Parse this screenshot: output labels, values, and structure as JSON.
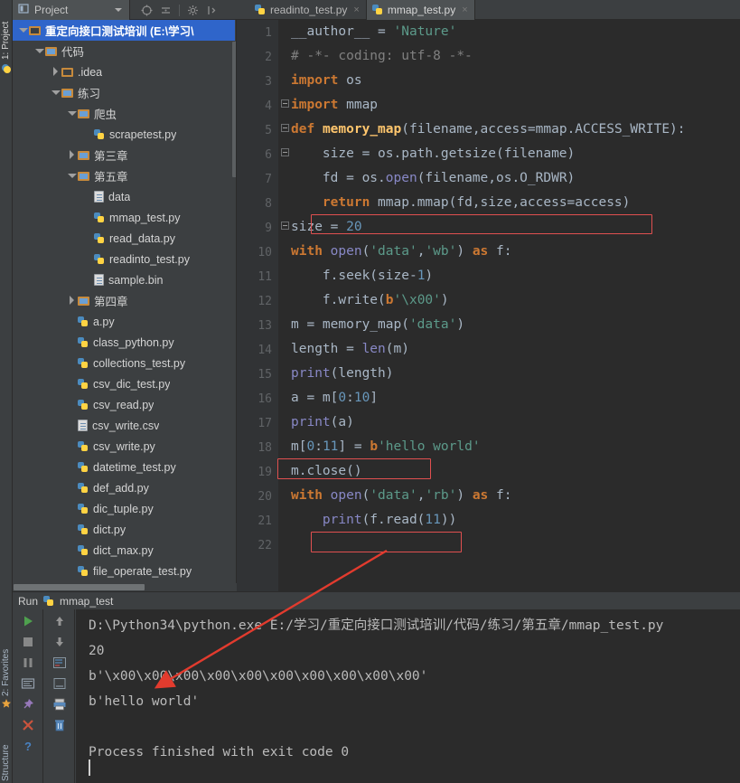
{
  "window": {
    "theme_bg": "#3c3f41",
    "editor_bg": "#2b2b2b",
    "accent": "#2f65ca",
    "highlight_box_color": "#e05050"
  },
  "left_strip": {
    "project_label": "1: Project",
    "favorites_label": "2: Favorites",
    "structure_label": "Structure"
  },
  "toolbar": {
    "project_label": "Project",
    "icons": [
      "target-icon",
      "collapse-all-icon",
      "settings-gear-icon",
      "expand-icon"
    ]
  },
  "tabs": [
    {
      "label": "readinto_test.py",
      "icon": "python-file-icon",
      "active": false,
      "close": "×"
    },
    {
      "label": "mmap_test.py",
      "icon": "python-file-icon",
      "active": true,
      "close": "×"
    }
  ],
  "project_tree": [
    {
      "label": "重定向接口测试培训 (E:\\学习\\",
      "depth": 0,
      "arrow": "down",
      "icon": "folder-plain",
      "selected": true
    },
    {
      "label": "代码",
      "depth": 1,
      "arrow": "down",
      "icon": "folder-src",
      "selected": false
    },
    {
      "label": ".idea",
      "depth": 2,
      "arrow": "right",
      "icon": "folder-plain",
      "selected": false
    },
    {
      "label": "练习",
      "depth": 2,
      "arrow": "down",
      "icon": "folder-src",
      "selected": false
    },
    {
      "label": "爬虫",
      "depth": 3,
      "arrow": "down",
      "icon": "folder-src",
      "selected": false
    },
    {
      "label": "scrapetest.py",
      "depth": 4,
      "arrow": "none",
      "icon": "python-file-icon",
      "selected": false
    },
    {
      "label": "第三章",
      "depth": 3,
      "arrow": "right",
      "icon": "folder-src",
      "selected": false
    },
    {
      "label": "第五章",
      "depth": 3,
      "arrow": "down",
      "icon": "folder-src",
      "selected": false
    },
    {
      "label": "data",
      "depth": 4,
      "arrow": "none",
      "icon": "file-icon",
      "selected": false
    },
    {
      "label": "mmap_test.py",
      "depth": 4,
      "arrow": "none",
      "icon": "python-file-icon",
      "selected": false
    },
    {
      "label": "read_data.py",
      "depth": 4,
      "arrow": "none",
      "icon": "python-file-icon",
      "selected": false
    },
    {
      "label": "readinto_test.py",
      "depth": 4,
      "arrow": "none",
      "icon": "python-file-icon",
      "selected": false
    },
    {
      "label": "sample.bin",
      "depth": 4,
      "arrow": "none",
      "icon": "file-icon",
      "selected": false
    },
    {
      "label": "第四章",
      "depth": 3,
      "arrow": "right",
      "icon": "folder-src",
      "selected": false
    },
    {
      "label": "a.py",
      "depth": 3,
      "arrow": "none",
      "icon": "python-file-icon",
      "selected": false
    },
    {
      "label": "class_python.py",
      "depth": 3,
      "arrow": "none",
      "icon": "python-file-icon",
      "selected": false
    },
    {
      "label": "collections_test.py",
      "depth": 3,
      "arrow": "none",
      "icon": "python-file-icon",
      "selected": false
    },
    {
      "label": "csv_dic_test.py",
      "depth": 3,
      "arrow": "none",
      "icon": "python-file-icon",
      "selected": false
    },
    {
      "label": "csv_read.py",
      "depth": 3,
      "arrow": "none",
      "icon": "python-file-icon",
      "selected": false
    },
    {
      "label": "csv_write.csv",
      "depth": 3,
      "arrow": "none",
      "icon": "file-icon",
      "selected": false
    },
    {
      "label": "csv_write.py",
      "depth": 3,
      "arrow": "none",
      "icon": "python-file-icon",
      "selected": false
    },
    {
      "label": "datetime_test.py",
      "depth": 3,
      "arrow": "none",
      "icon": "python-file-icon",
      "selected": false
    },
    {
      "label": "def_add.py",
      "depth": 3,
      "arrow": "none",
      "icon": "python-file-icon",
      "selected": false
    },
    {
      "label": "dic_tuple.py",
      "depth": 3,
      "arrow": "none",
      "icon": "python-file-icon",
      "selected": false
    },
    {
      "label": "dict.py",
      "depth": 3,
      "arrow": "none",
      "icon": "python-file-icon",
      "selected": false
    },
    {
      "label": "dict_max.py",
      "depth": 3,
      "arrow": "none",
      "icon": "python-file-icon",
      "selected": false
    },
    {
      "label": "file_operate_test.py",
      "depth": 3,
      "arrow": "none",
      "icon": "python-file-icon",
      "selected": false
    }
  ],
  "editor": {
    "file": "mmap_test.py",
    "first_line": 1,
    "last_line": 22,
    "line_numbers": [
      1,
      2,
      3,
      4,
      5,
      6,
      7,
      8,
      9,
      10,
      11,
      12,
      13,
      14,
      15,
      16,
      17,
      18,
      19,
      20,
      21,
      22
    ],
    "lines": [
      "__author__ = 'Nature'",
      "# -*- coding: utf-8 -*-",
      "import os",
      "import mmap",
      "def memory_map(filename,access=mmap.ACCESS_WRITE):",
      "    size = os.path.getsize(filename)",
      "    fd = os.open(filename,os.O_RDWR)",
      "    return mmap.mmap(fd,size,access=access)",
      "size = 20",
      "with open('data','wb') as f:",
      "    f.seek(size-1)",
      "    f.write(b'\\x00')",
      "m = memory_map('data')",
      "length = len(m)",
      "print(length)",
      "a = m[0:10]",
      "print(a)",
      "m[0:11] = b'hello world'",
      "m.close()",
      "with open('data','rb') as f:",
      "    print(f.read(11))",
      ""
    ],
    "highlighted_lines": [
      8,
      18,
      21
    ]
  },
  "run_panel": {
    "tab_label": "Run",
    "config_name": "mmap_test",
    "config_icon": "python-file-icon",
    "left_buttons": [
      "rerun-play-icon",
      "stop-icon",
      "pause-icon",
      "console-icon",
      "pin-icon",
      "close-x-icon",
      "help-icon"
    ],
    "right_buttons": [
      "scroll-up-icon",
      "scroll-down-icon",
      "soft-wrap-icon",
      "scroll-to-end-icon",
      "print-icon",
      "clear-all-trash-icon"
    ],
    "console_lines": [
      "D:\\Python34\\python.exe E:/学习/重定向接口测试培训/代码/练习/第五章/mmap_test.py",
      "20",
      "b'\\x00\\x00\\x00\\x00\\x00\\x00\\x00\\x00\\x00\\x00'",
      "b'hello world'",
      "",
      "Process finished with exit code 0"
    ]
  }
}
